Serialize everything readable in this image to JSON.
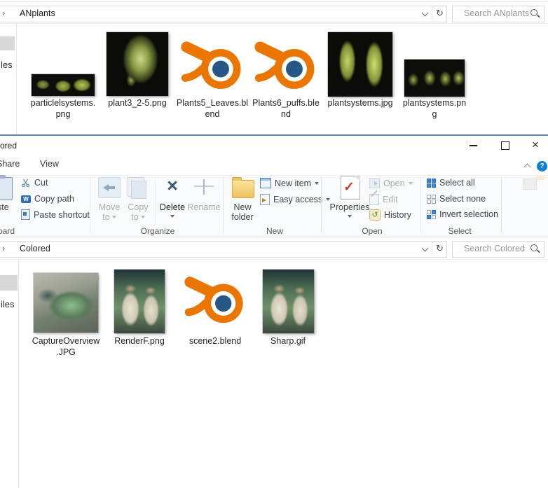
{
  "glyphs": {
    "close": "×",
    "refresh": "↻",
    "breadcrumb": "›",
    "help": "?",
    "check": "✓",
    "w_letter": "W",
    "history_arrow": "↺",
    "delete_x": "×"
  },
  "top_window": {
    "address_text": "ANplants",
    "search_placeholder": "Search ANplants",
    "sidebar_fragment": "les",
    "files": [
      {
        "line1": "particlelsystems.",
        "line2": "png"
      },
      {
        "line1": "plant3_2-5.png",
        "line2": ""
      },
      {
        "line1": "Plants5_Leaves.bl",
        "line2": "end"
      },
      {
        "line1": "Plants6_puffs.ble",
        "line2": "nd"
      },
      {
        "line1": "plantsystems.jpg",
        "line2": ""
      },
      {
        "line1": "plantsystems.pn",
        "line2": "g"
      }
    ]
  },
  "bottom_window": {
    "title_fragment": "ored",
    "menu": {
      "share": "Share",
      "view": "View"
    },
    "address_text": "Colored",
    "search_placeholder": "Search Colored",
    "sidebar_fragment": "iles",
    "ribbon": {
      "clipboard": {
        "paste_fragment": "ste",
        "cut": "Cut",
        "copy_path": "Copy path",
        "paste_shortcut": "Paste shortcut",
        "group_fragment": "oard"
      },
      "organize": {
        "move_l1": "Move",
        "move_l2": "to",
        "copy_l1": "Copy",
        "copy_l2": "to",
        "delete": "Delete",
        "rename": "Rename",
        "group": "Organize"
      },
      "new": {
        "new_folder_l1": "New",
        "new_folder_l2": "folder",
        "new_item": "New item",
        "easy_access": "Easy access",
        "group": "New"
      },
      "open": {
        "properties": "Properties",
        "open": "Open",
        "edit": "Edit",
        "history": "History",
        "group": "Open"
      },
      "select": {
        "select_all": "Select all",
        "select_none": "Select none",
        "invert": "Invert selection",
        "group": "Select"
      }
    },
    "files": [
      {
        "line1": "CaptureOverview",
        "line2": ".JPG"
      },
      {
        "line1": "RenderF.png",
        "line2": ""
      },
      {
        "line1": "scene2.blend",
        "line2": ""
      },
      {
        "line1": "Sharp.gif",
        "line2": ""
      }
    ]
  },
  "colors": {
    "blender_orange": "#EA7600",
    "blender_blue": "#265787",
    "selection_blue": "#3E86D8",
    "titlebar_edge": "#5F82A0",
    "help_blue": "#0F7FD8"
  }
}
